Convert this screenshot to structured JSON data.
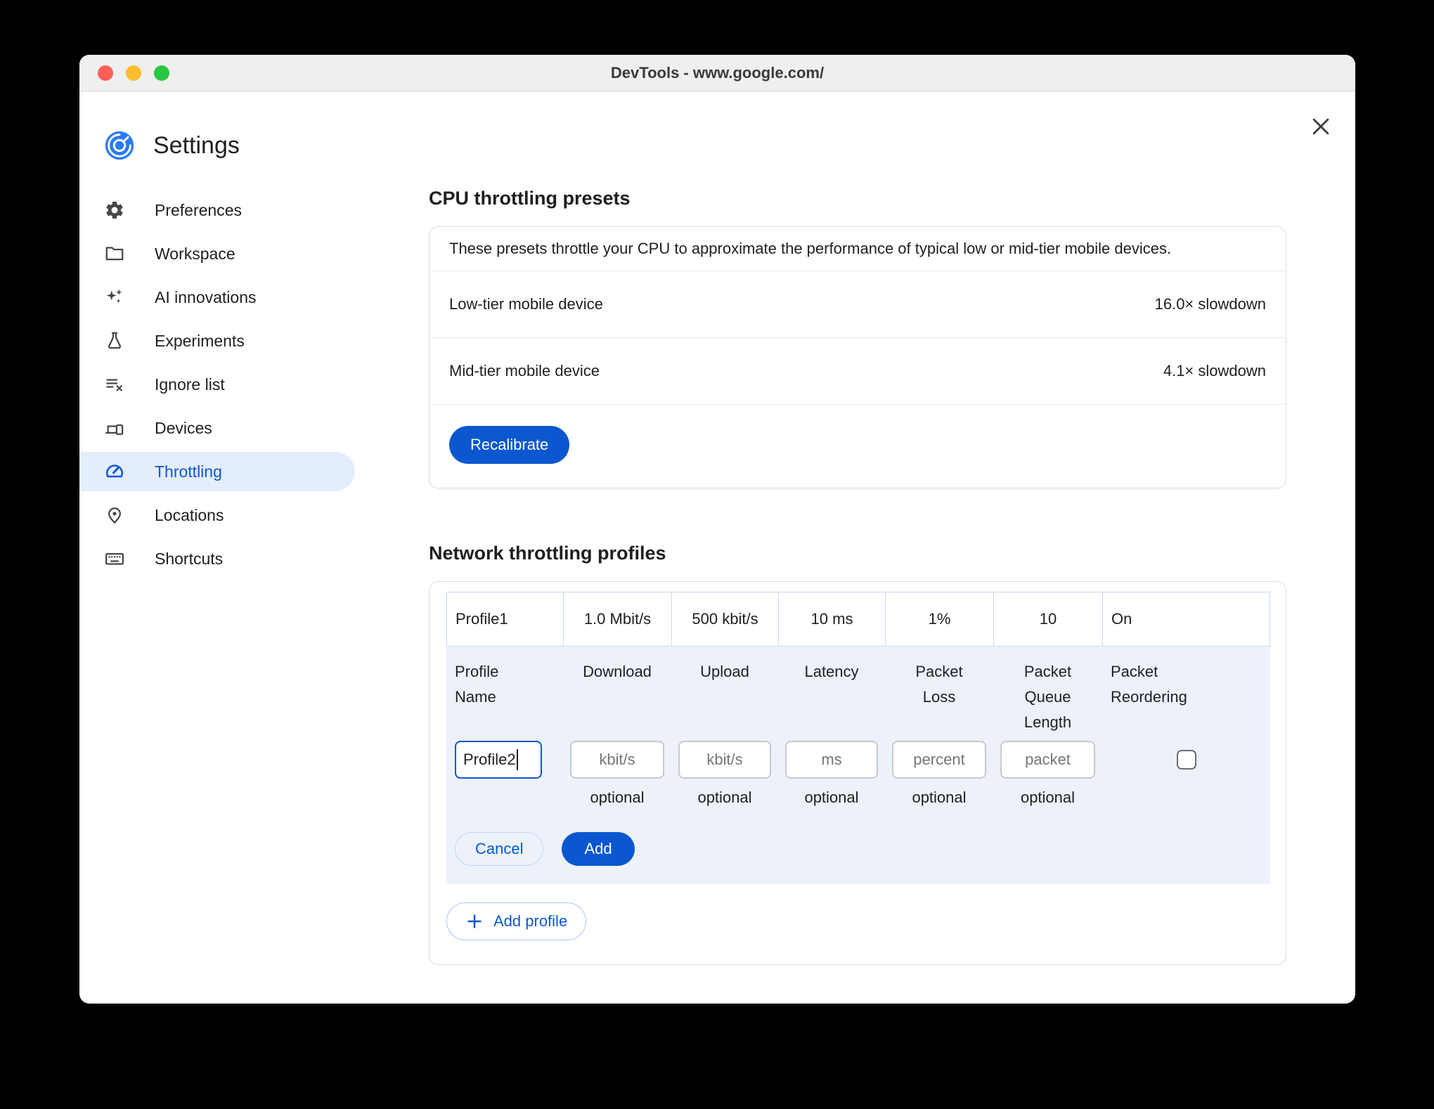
{
  "window": {
    "title": "DevTools - www.google.com/"
  },
  "sidebar": {
    "title": "Settings",
    "items": [
      {
        "label": "Preferences",
        "icon": "gear-icon",
        "selected": false
      },
      {
        "label": "Workspace",
        "icon": "folder-icon",
        "selected": false
      },
      {
        "label": "AI innovations",
        "icon": "sparkles-icon",
        "selected": false
      },
      {
        "label": "Experiments",
        "icon": "flask-icon",
        "selected": false
      },
      {
        "label": "Ignore list",
        "icon": "ignore-list-icon",
        "selected": false
      },
      {
        "label": "Devices",
        "icon": "devices-icon",
        "selected": false
      },
      {
        "label": "Throttling",
        "icon": "speedometer-icon",
        "selected": true
      },
      {
        "label": "Locations",
        "icon": "location-pin-icon",
        "selected": false
      },
      {
        "label": "Shortcuts",
        "icon": "keyboard-icon",
        "selected": false
      }
    ]
  },
  "cpu_section": {
    "heading": "CPU throttling presets",
    "description": "These presets throttle your CPU to approximate the performance of typical low or mid-tier mobile devices.",
    "presets": [
      {
        "name": "Low-tier mobile device",
        "value": "16.0× slowdown"
      },
      {
        "name": "Mid-tier mobile device",
        "value": "4.1× slowdown"
      }
    ],
    "recalibrate_label": "Recalibrate"
  },
  "network_section": {
    "heading": "Network throttling profiles",
    "profile_row": {
      "name": "Profile1",
      "download": "1.0 Mbit/s",
      "upload": "500 kbit/s",
      "latency": "10 ms",
      "packet_loss": "1%",
      "packet_queue_length": "10",
      "packet_reordering": "On"
    },
    "columns": [
      "Profile Name",
      "Download",
      "Upload",
      "Latency",
      "Packet Loss",
      "Packet Queue Length",
      "Packet Reordering"
    ],
    "editor": {
      "name_value": "Profile2",
      "placeholders": {
        "download": "kbit/s",
        "upload": "kbit/s",
        "latency": "ms",
        "packet_loss": "percent",
        "packet_queue": "packet"
      },
      "optional_label": "optional",
      "cancel_label": "Cancel",
      "add_label": "Add"
    },
    "add_profile_label": "Add profile"
  },
  "colors": {
    "accent_blue": "#0b57d0",
    "selected_item_bg": "#e4edfc",
    "table_area_bg": "#edf2fa",
    "table_border": "#c9d8f3",
    "traffic_red": "#ff5f57",
    "traffic_yellow": "#febc2e",
    "traffic_green": "#28c840"
  }
}
